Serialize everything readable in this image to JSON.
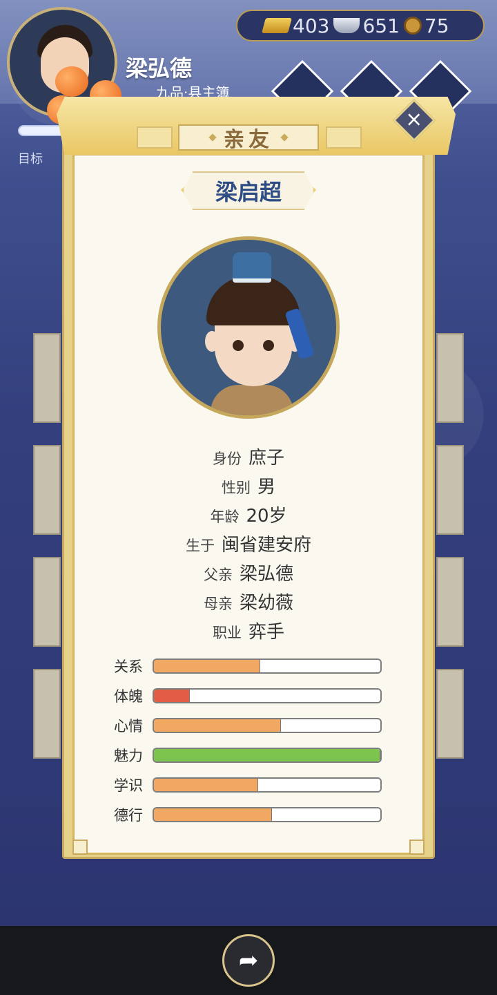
{
  "header": {
    "player_name": "梁弘德",
    "player_rank": "九品·县主簿",
    "goal_label": "目标"
  },
  "currency": {
    "gold": "403",
    "silver": "651",
    "coins": "75"
  },
  "dialog": {
    "title": "亲友",
    "close_label": "×",
    "character_name": "梁启超",
    "details": [
      {
        "label": "身份",
        "value": "庶子"
      },
      {
        "label": "性别",
        "value": "男"
      },
      {
        "label": "年龄",
        "value": "20岁"
      },
      {
        "label": "生于",
        "value": "闽省建安府"
      },
      {
        "label": "父亲",
        "value": "梁弘德"
      },
      {
        "label": "母亲",
        "value": "梁幼薇"
      },
      {
        "label": "职业",
        "value": "弈手"
      }
    ],
    "stats": [
      {
        "label": "关系",
        "fraction": 0.47,
        "color": "#f0a862"
      },
      {
        "label": "体魄",
        "fraction": 0.16,
        "color": "#e35c45"
      },
      {
        "label": "心情",
        "fraction": 0.56,
        "color": "#f0a862"
      },
      {
        "label": "魅力",
        "fraction": 1.0,
        "color": "#7dc44f"
      },
      {
        "label": "学识",
        "fraction": 0.46,
        "color": "#f0a862"
      },
      {
        "label": "德行",
        "fraction": 0.52,
        "color": "#f0a862"
      }
    ]
  },
  "footer": {
    "share_icon": "share-icon"
  }
}
